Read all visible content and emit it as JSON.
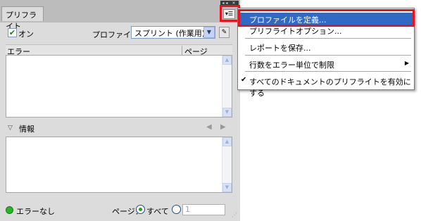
{
  "panel": {
    "tab_label": "プリフライト",
    "window_controls": "◂◂ ✕",
    "menu_icon": "▾☰",
    "on_label": "オン",
    "on_check": "✔",
    "profile_label": "プロファイル：",
    "profile_value": "スプリント (作業用)",
    "profile_arrow": "▼",
    "profile_edit_icon": "✎",
    "error_columns": [
      "エラー",
      "ページ"
    ],
    "info_label": "情報",
    "info_toggle": "▽",
    "info_prev": "◀",
    "info_next": "▶",
    "status_text": "エラーなし",
    "page_label": "ページ：",
    "all_label": "すべて",
    "range_value": "1",
    "scroll_up": "▲",
    "scroll_down": "▼"
  },
  "menu": {
    "items": [
      {
        "label": "プロファイルを定義..."
      },
      {
        "label": "プリフライトオプション..."
      },
      {
        "label": "レポートを保存..."
      },
      {
        "label": "行数をエラー単位で制限",
        "arrow": "▶"
      },
      {
        "label": "すべてのドキュメントのプリフライトを有効にする",
        "check": "✔"
      }
    ]
  },
  "colors": {
    "highlight": "#316ac5",
    "annotation": "#e8141c",
    "status_ok": "#28b428"
  }
}
